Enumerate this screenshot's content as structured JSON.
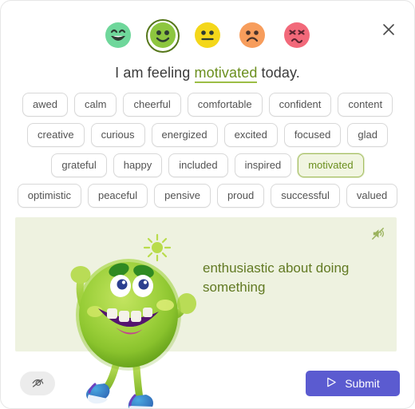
{
  "window": {
    "close_label": "×",
    "close_icon": "close-icon"
  },
  "mood_selector": {
    "options": [
      {
        "name": "very-happy",
        "icon": "grinning-face-icon",
        "face": "grin",
        "color": "#6fd79b",
        "selected": false
      },
      {
        "name": "happy",
        "icon": "smiling-face-icon",
        "face": "smile",
        "color": "#8dc63f",
        "selected": true
      },
      {
        "name": "neutral",
        "icon": "neutral-face-icon",
        "face": "neutral",
        "color": "#f4d71a",
        "selected": false
      },
      {
        "name": "sad",
        "icon": "frowning-face-icon",
        "face": "sad",
        "color": "#f79d5c",
        "selected": false
      },
      {
        "name": "angry",
        "icon": "confounded-face-icon",
        "face": "angry",
        "color": "#f2697a",
        "selected": false
      }
    ],
    "selected_index": 1
  },
  "prompt": {
    "prefix": "I am feeling ",
    "word": "motivated",
    "suffix": " today."
  },
  "chips": {
    "rows": [
      [
        "awed",
        "calm",
        "cheerful",
        "comfortable",
        "confident",
        "content",
        "creative"
      ],
      [
        "curious",
        "energized",
        "excited",
        "focused",
        "glad",
        "grateful",
        "happy"
      ],
      [
        "included",
        "inspired",
        "motivated",
        "optimistic",
        "peaceful",
        "pensive",
        "proud"
      ],
      [
        "successful",
        "valued"
      ]
    ],
    "selected": "motivated"
  },
  "definition": {
    "text": "enthusiastic about doing something",
    "mute_icon": "speaker-muted-icon",
    "illustration_name": "green-furry-monster-character",
    "panel_color": "#eef2e0",
    "text_color": "#627a23"
  },
  "footer": {
    "hide_answer_icon": "eye-off-icon",
    "submit_label": "Submit",
    "submit_icon": "send-icon",
    "submit_color": "#5b5bd0"
  }
}
